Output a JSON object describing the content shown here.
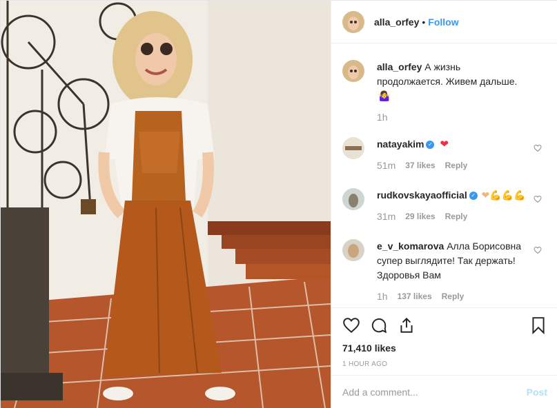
{
  "post": {
    "username": "alla_orfey",
    "separator": "•",
    "follow_label": "Follow",
    "caption_user": "alla_orfey",
    "caption_text": "А жизнь продолжается. Живем дальше.",
    "caption_emoji": "🤷‍♀️",
    "caption_time": "1h"
  },
  "comments": [
    {
      "user": "natayakim",
      "verified": true,
      "text": "",
      "emoji": "❤",
      "time": "51m",
      "likes": "37 likes",
      "reply": "Reply"
    },
    {
      "user": "rudkovskayaofficial",
      "verified": true,
      "text": "",
      "emoji": "❤💪💪💪",
      "time": "31m",
      "likes": "29 likes",
      "reply": "Reply"
    },
    {
      "user": "e_v_komarova",
      "verified": false,
      "text": "Алла Борисовна супер выглядите! Так держать! Здоровья Вам",
      "emoji": "",
      "time": "1h",
      "likes": "137 likes",
      "reply": "Reply"
    }
  ],
  "actions": {
    "like_icon": "heart-icon",
    "comment_icon": "comment-icon",
    "share_icon": "share-icon",
    "save_icon": "bookmark-icon",
    "likes_label": "71,410 likes",
    "time_label": "1 HOUR AGO"
  },
  "composer": {
    "placeholder": "Add a comment...",
    "post_label": "Post"
  },
  "colors": {
    "accent": "#3897f0",
    "heart": "#ed2e44",
    "post_disabled": "#b2dffc"
  }
}
